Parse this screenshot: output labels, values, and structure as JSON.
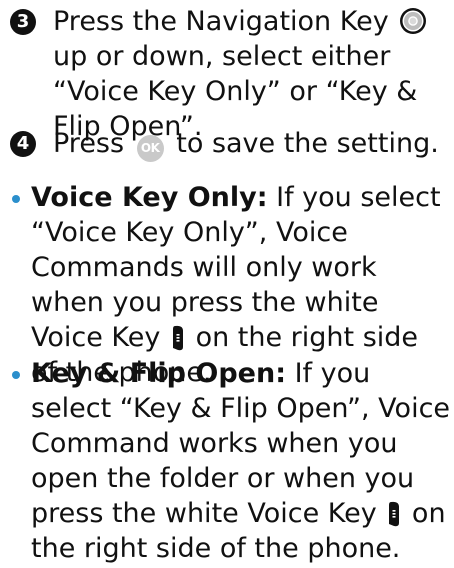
{
  "step3": {
    "number": "3",
    "text_before": "Press the Navigation Key",
    "text_after": "up or down, select either “Voice Key Only” or “Key & Flip Open”.",
    "icon": "navigation-key-icon"
  },
  "step4": {
    "number": "4",
    "text_before": "Press",
    "ok_label": "OK",
    "text_after": "to save the setting.",
    "icon": "ok-key-icon"
  },
  "bullets": [
    {
      "term": "Voice Key Only:",
      "text_before": "If you select “Voice Key Only”, Voice Commands will only work when you press the white Voice Key",
      "text_after": "on the right side of the phone.",
      "icon": "voice-key-icon"
    },
    {
      "term": "Key & Flip Open:",
      "text_before": "If you select “Key & Flip Open”, Voice Command works when you open the folder or when you press the white Voice Key",
      "text_after": "on the right side of the phone.",
      "icon": "voice-key-icon"
    }
  ],
  "colors": {
    "bullet": "#2b8fcc",
    "step_badge": "#111111",
    "ok_key": "#c9c9c9"
  }
}
